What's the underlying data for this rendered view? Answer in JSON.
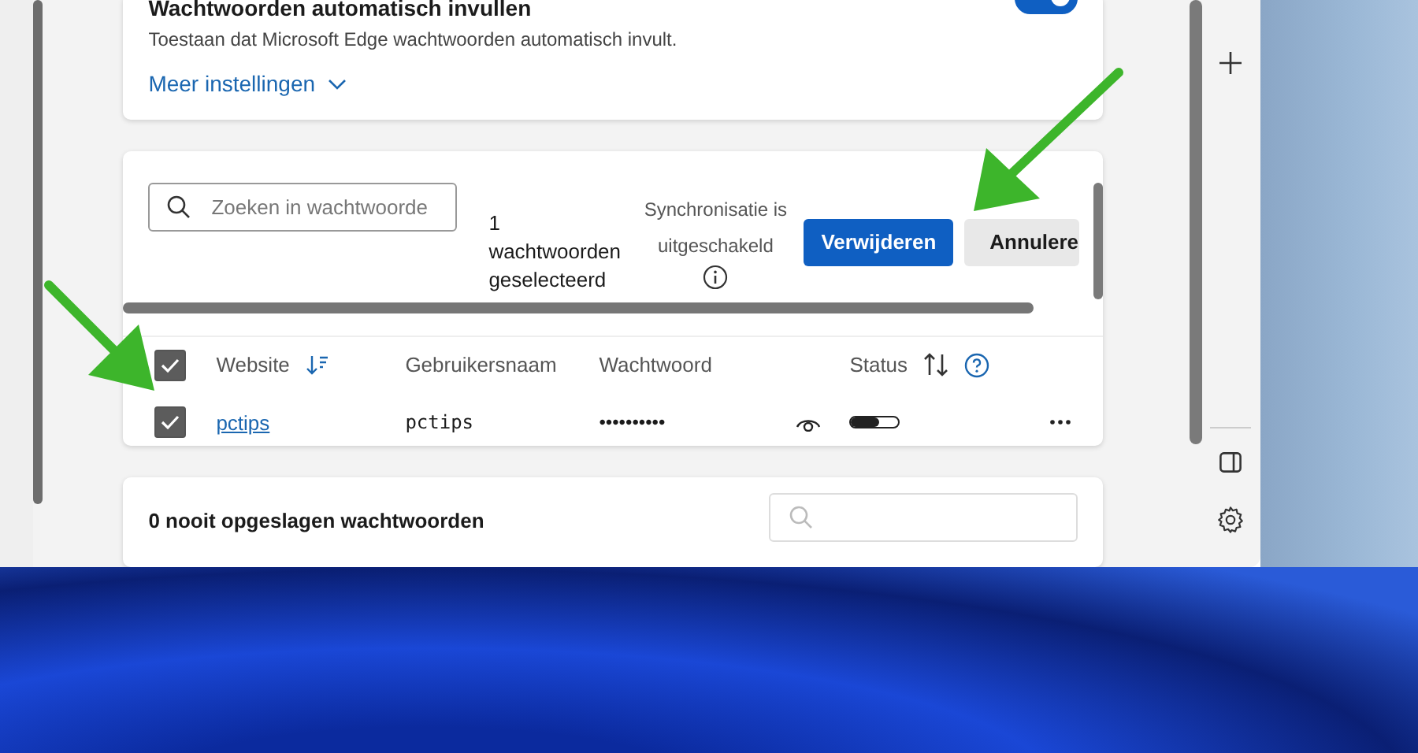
{
  "autofill_card": {
    "title": "Wachtwoorden automatisch invullen",
    "toggle_on": true,
    "description": "Toestaan dat Microsoft Edge wachtwoorden automatisch invult.",
    "more_link": "Meer instellingen"
  },
  "passwords_card": {
    "search": {
      "placeholder": "Zoeken in wachtwoorde"
    },
    "selection_count": "1 wachtwoorden geselecteerd",
    "sync_status": "Synchronisatie is uitgeschakeld",
    "buttons": [
      {
        "label": "Verwijderen",
        "kind": "primary"
      },
      {
        "label": "Annulere",
        "kind": "secondary"
      }
    ],
    "select_all_checked": true,
    "columns": [
      {
        "label": "Website",
        "kind": "sort-down"
      },
      {
        "label": "Gebruikersnaam",
        "kind": "plain"
      },
      {
        "label": "Wachtwoord",
        "kind": "plain"
      },
      {
        "label": "Status",
        "kind": "sort-help"
      }
    ],
    "rows": [
      {
        "checked": true,
        "website": "pctips",
        "username": "pctips",
        "password": "••••••••••",
        "level": 0.6
      }
    ]
  },
  "never_saved_card": {
    "title": "0 nooit opgeslagen wachtwoorden"
  }
}
